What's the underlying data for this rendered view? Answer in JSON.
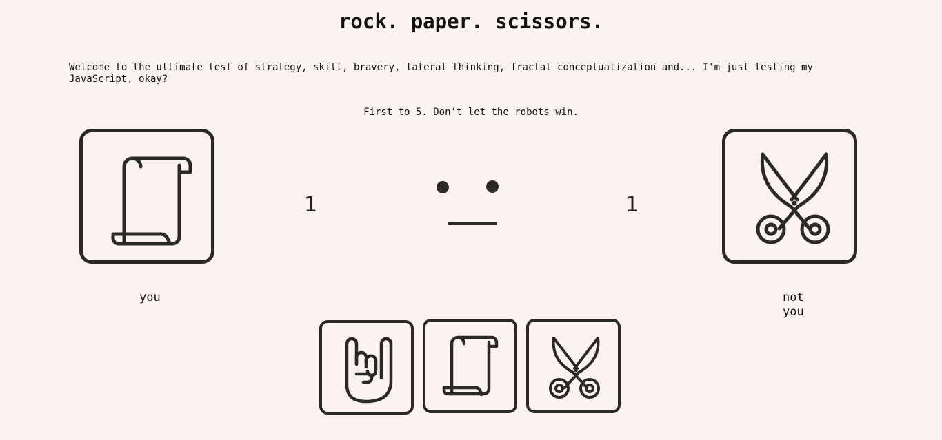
{
  "header": {
    "title": "rock. paper. scissors."
  },
  "intro_text": "Welcome to the ultimate test of strategy, skill, bravery, lateral thinking, fractal conceptualization and... I'm just testing my JavaScript, okay?",
  "rules_text": "First to 5. Don't let the robots win.",
  "player": {
    "label": "you",
    "score": "1",
    "choice_icon": "paper-scroll-icon"
  },
  "computer": {
    "label": "not you",
    "score": "1",
    "choice_icon": "scissors-icon"
  },
  "status_face": "neutral-face-icon",
  "choices": [
    {
      "name": "rock",
      "icon": "rock-hand-icon"
    },
    {
      "name": "paper",
      "icon": "paper-scroll-icon"
    },
    {
      "name": "scissors",
      "icon": "scissors-icon"
    }
  ],
  "colors": {
    "background": "#fcf2ef",
    "stroke": "#2b2927"
  }
}
